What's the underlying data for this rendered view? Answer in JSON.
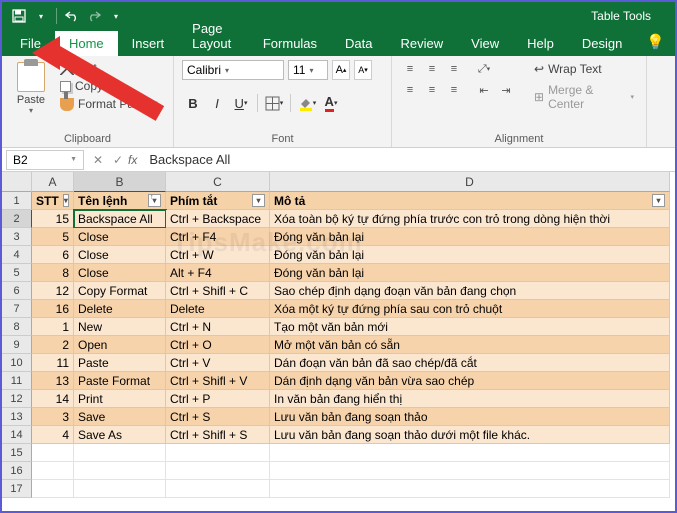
{
  "title_tools": "Table Tools",
  "tabs": [
    "File",
    "Home",
    "Insert",
    "Page Layout",
    "Formulas",
    "Data",
    "Review",
    "View",
    "Help",
    "Design"
  ],
  "active_tab": "Home",
  "clipboard": {
    "paste": "Paste",
    "cut": "Cut",
    "copy": "Copy",
    "format_painter": "Format Painter",
    "group_label": "Clipboard"
  },
  "font": {
    "name": "Calibri",
    "size": "11",
    "group_label": "Font"
  },
  "alignment": {
    "wrap": "Wrap Text",
    "merge": "Merge & Center",
    "group_label": "Alignment"
  },
  "namebox": "B2",
  "formula_value": "Backspace All",
  "columns": [
    "A",
    "B",
    "C",
    "D"
  ],
  "col_widths": [
    "cw-a",
    "cw-b",
    "cw-c",
    "cw-d"
  ],
  "headers": {
    "a": "STT",
    "b": "Tên lệnh",
    "c": "Phím tắt",
    "d": "Mô tả"
  },
  "rows": [
    {
      "n": "2",
      "stt": "15",
      "cmd": "Backspace All",
      "key": "Ctrl + Backspace",
      "desc": "Xóa toàn bộ ký tự đứng phía trước con trỏ trong dòng hiện thời"
    },
    {
      "n": "3",
      "stt": "5",
      "cmd": "Close",
      "key": "Ctrl + F4",
      "desc": "Đóng văn bản lại"
    },
    {
      "n": "4",
      "stt": "6",
      "cmd": "Close",
      "key": "Ctrl + W",
      "desc": "Đóng văn bản lại"
    },
    {
      "n": "5",
      "stt": "8",
      "cmd": "Close",
      "key": "Alt + F4",
      "desc": "Đóng văn bản lại"
    },
    {
      "n": "6",
      "stt": "12",
      "cmd": "Copy Format",
      "key": "Ctrl + Shifl + C",
      "desc": "Sao chép định dạng đoạn văn bản đang chọn"
    },
    {
      "n": "7",
      "stt": "16",
      "cmd": "Delete",
      "key": "Delete",
      "desc": "Xóa một ký tự đứng phía sau con trỏ chuột"
    },
    {
      "n": "8",
      "stt": "1",
      "cmd": "New",
      "key": "Ctrl + N",
      "desc": "Tạo một văn bản mới"
    },
    {
      "n": "9",
      "stt": "2",
      "cmd": "Open",
      "key": "Ctrl + O",
      "desc": "Mở một văn bản có sẵn"
    },
    {
      "n": "10",
      "stt": "11",
      "cmd": "Paste",
      "key": "Ctrl + V",
      "desc": "Dán đoạn văn bản đã sao chép/đã cắt"
    },
    {
      "n": "11",
      "stt": "13",
      "cmd": "Paste Format",
      "key": "Ctrl + Shifl + V",
      "desc": "Dán định dạng văn bản vừa sao chép"
    },
    {
      "n": "12",
      "stt": "14",
      "cmd": "Print",
      "key": "Ctrl + P",
      "desc": "In văn bản đang hiển thị"
    },
    {
      "n": "13",
      "stt": "3",
      "cmd": "Save",
      "key": "Ctrl + S",
      "desc": "Lưu văn bản đang soạn thảo"
    },
    {
      "n": "14",
      "stt": "4",
      "cmd": "Save As",
      "key": "Ctrl + Shifl + S",
      "desc": "Lưu văn bản đang soạn thảo dưới một file khác."
    }
  ],
  "watermark": "TipsMake.com"
}
